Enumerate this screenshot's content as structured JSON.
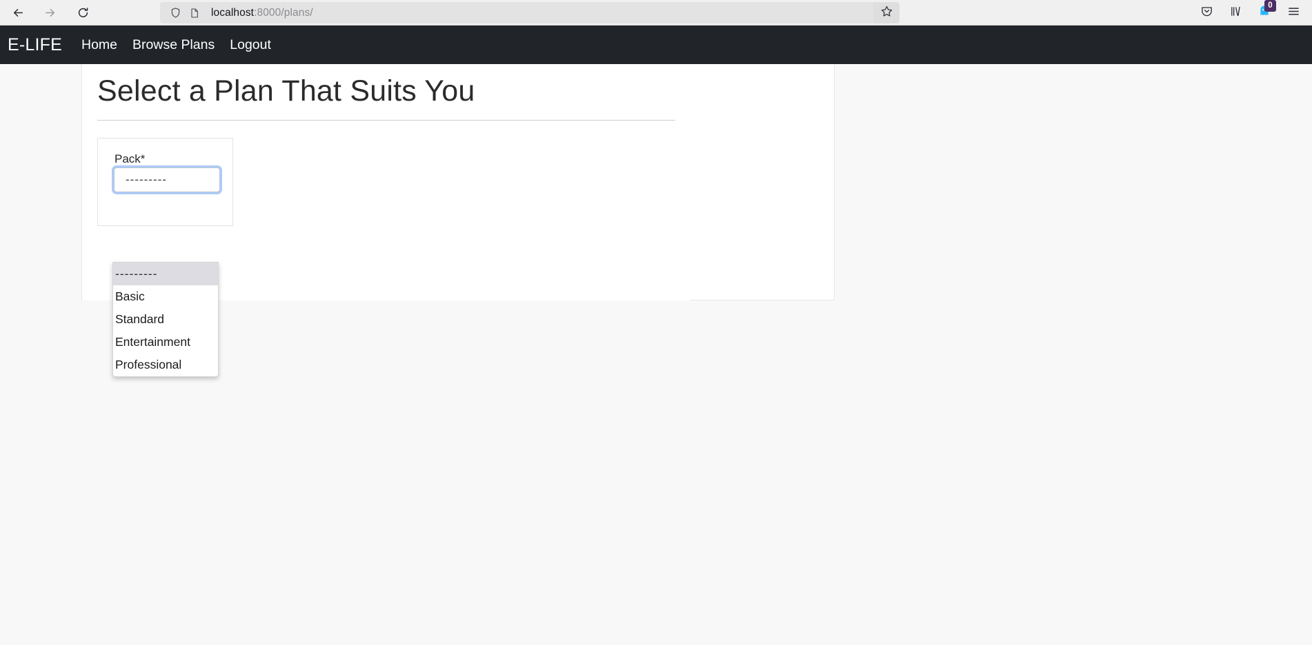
{
  "browser": {
    "back_icon": "arrow-left-icon",
    "forward_icon": "arrow-right-icon",
    "reload_icon": "reload-icon",
    "shield_icon": "shield-icon",
    "page_icon": "page-document-icon",
    "url_host": "localhost",
    "url_path": ":8000/plans/",
    "url_full": "localhost:8000/plans/",
    "star_icon": "star-bookmark-icon",
    "pocket_icon": "pocket-save-icon",
    "library_icon": "library-icon",
    "extension_icon": "ghost-extension-icon",
    "extension_badge_count": "0",
    "menu_icon": "hamburger-menu-icon"
  },
  "navbar": {
    "brand": "E-LIFE",
    "links": [
      {
        "label": "Home"
      },
      {
        "label": "Browse Plans"
      },
      {
        "label": "Logout"
      }
    ]
  },
  "main": {
    "title": "Select a Plan That Suits You",
    "form": {
      "pack_label": "Pack*",
      "pack_selected_value": "---------",
      "pack_options": [
        "---------",
        "Basic",
        "Standard",
        "Entertainment",
        "Professional"
      ]
    }
  },
  "colors": {
    "navbar_bg": "#212529",
    "page_bg": "#f8f8f9",
    "focus_ring": "#aecbfa",
    "badge_bg": "#4b2e63",
    "extension_blue": "#29b6f6"
  }
}
